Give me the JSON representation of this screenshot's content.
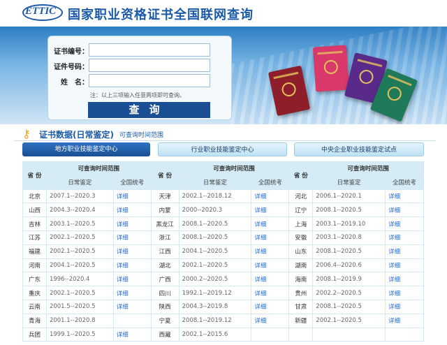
{
  "header": {
    "logo_text": "ETTIC",
    "title": "国家职业资格证书全国联网查询"
  },
  "form": {
    "cert_label": "证书编号：",
    "id_label": "证件号码：",
    "name_label": "姓　名：",
    "cert_value": "",
    "id_value": "",
    "name_value": "",
    "note": "注：以上三项输入任意两项即可查询。",
    "query_label": "查询"
  },
  "section": {
    "title": "证书数据(日常鉴定)",
    "subtitle": "可查询时间范围"
  },
  "tabs": [
    {
      "label": "地方职业技能鉴定中心",
      "active": true
    },
    {
      "label": "行业职业技能鉴定中心",
      "active": false
    },
    {
      "label": "中央企业职业技能鉴定试点",
      "active": false
    }
  ],
  "table": {
    "province_header": "省 份",
    "range_header": "可查询时间范围",
    "daily_header": "日常鉴定",
    "national_header": "全国统考",
    "detail_text": "详细",
    "rows": [
      [
        {
          "p": "北京",
          "r": "2007.1--2020.3",
          "d": "详细"
        },
        {
          "p": "天津",
          "r": "2002.1--2018.12",
          "d": "详细"
        },
        {
          "p": "河北",
          "r": "2006.1--2020.1",
          "d": "详细"
        }
      ],
      [
        {
          "p": "山西",
          "r": "2004.3--2020.4",
          "d": "详细"
        },
        {
          "p": "内蒙",
          "r": "2000--2020.3",
          "d": "详细"
        },
        {
          "p": "辽宁",
          "r": "2008.1--2020.5",
          "d": "详细"
        }
      ],
      [
        {
          "p": "吉林",
          "r": "2003.1--2020.5",
          "d": "详细"
        },
        {
          "p": "黑龙江",
          "r": "2008.1--2020.5",
          "d": "详细"
        },
        {
          "p": "上海",
          "r": "2003.1--2019.10",
          "d": "详细"
        }
      ],
      [
        {
          "p": "江苏",
          "r": "2002.1--2020.5",
          "d": "详细"
        },
        {
          "p": "浙江",
          "r": "2008.1--2020.5",
          "d": "详细"
        },
        {
          "p": "安徽",
          "r": "2003.1--2020.8",
          "d": "详细"
        }
      ],
      [
        {
          "p": "福建",
          "r": "2002.1--2020.5",
          "d": "详细"
        },
        {
          "p": "江西",
          "r": "2004.1--2020.5",
          "d": "详细"
        },
        {
          "p": "山东",
          "r": "2008.1--2020.5",
          "d": "详细"
        }
      ],
      [
        {
          "p": "河南",
          "r": "2004.1--2020.5",
          "d": "详细"
        },
        {
          "p": "湖北",
          "r": "2002.1--2020.5",
          "d": "详细"
        },
        {
          "p": "湖南",
          "r": "2006.4--2020.6",
          "d": "详细"
        }
      ],
      [
        {
          "p": "广东",
          "r": "1996--2020.4",
          "d": "详细"
        },
        {
          "p": "广西",
          "r": "2000.2--2020.5",
          "d": "详细"
        },
        {
          "p": "海南",
          "r": "2008.1--2019.9",
          "d": "详细"
        }
      ],
      [
        {
          "p": "重庆",
          "r": "2002.1--2020.5",
          "d": "详细"
        },
        {
          "p": "四川",
          "r": "1992.1--2019.12",
          "d": "详细"
        },
        {
          "p": "贵州",
          "r": "2002.2--2020.5",
          "d": "详细"
        }
      ],
      [
        {
          "p": "云南",
          "r": "2001.5--2020.5",
          "d": "详细"
        },
        {
          "p": "陕西",
          "r": "2004.3--2019.8",
          "d": "详细"
        },
        {
          "p": "甘肃",
          "r": "2008.1--2020.5",
          "d": "详细"
        }
      ],
      [
        {
          "p": "青海",
          "r": "2001.1--2020.8",
          "d": ""
        },
        {
          "p": "宁夏",
          "r": "2008.1--2019.12",
          "d": "详细"
        },
        {
          "p": "新疆",
          "r": "2002.1--2020.5",
          "d": "详细"
        }
      ],
      [
        {
          "p": "兵团",
          "r": "1999.1--2020.5",
          "d": "详细"
        },
        {
          "p": "西藏",
          "r": "2002.1--2015.6",
          "d": ""
        },
        {
          "p": "",
          "r": "",
          "d": ""
        }
      ]
    ]
  },
  "colors": {
    "brand_blue": "#1a5aa8",
    "button_navy": "#1b4f93",
    "link_blue": "#2a6ad0"
  }
}
